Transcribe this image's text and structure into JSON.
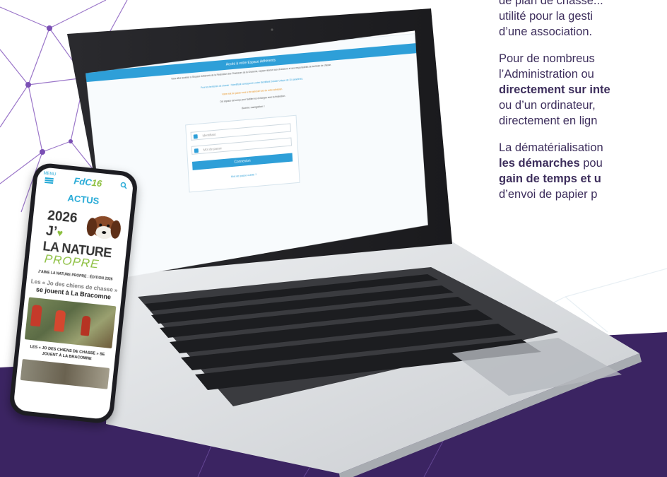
{
  "side_text": {
    "line1": "de plan de chasse...",
    "line2": "utilité pour la gesti",
    "line3": "d’une association.",
    "para2_line1": "Pour de nombreus",
    "para2_line2": "l’Administration ou",
    "para2_line3_bold": "directement sur inte",
    "para2_line4": "ou d’un ordinateur,",
    "para2_line5": "directement en lign",
    "para3_line1": "La dématérialisation",
    "para3_line2_bold": "les démarches",
    "para3_line2_rest": " pou",
    "para3_line3_bold": "gain de temps et u",
    "para3_line4": "d’envoi de papier p"
  },
  "laptop_site": {
    "panel_title": "Accès à votre Espace Adhérents",
    "intro": "Vous allez accéder à l’Espace Adhérents de la Fédération des Chasseurs de la Charente, espace réservé aux chasseurs et aux responsables de territoire de chasse.",
    "id_note": "Pour les territoires de chasse : l’identifiant correspond à votre identifiant Dossier Unique de 10 caractères.",
    "orange_note": "Votre mot de passe vous a été adressé lors de votre adhésion.",
    "help_note": "Cet espace est conçu pour faciliter les échanges avec la fédération.",
    "welcome": "Bonne navigation !",
    "id_placeholder": "Identifiant",
    "pw_placeholder": "Mot de passe",
    "connect_label": "Connexion",
    "forgot_label": "Mot de passe oublié ?"
  },
  "phone": {
    "menu_label": "MENU",
    "brand_main": "FdC",
    "brand_num": "16",
    "section": "ACTUS",
    "year": "2026",
    "j_letter": "J’",
    "heart": "♥",
    "nature": "LA NATURE",
    "propre": "PROPRE",
    "caption": "J’AIME LA NATURE PROPRE : ÉDITION 2026",
    "headline_ghost": "Les « Jo des chiens de chasse »",
    "headline": "se jouent à La Bracomne",
    "bottom_caption": "LES « JO DES CHIENS DE CHASSE » SE JOUENT À LA BRACOMNE"
  }
}
